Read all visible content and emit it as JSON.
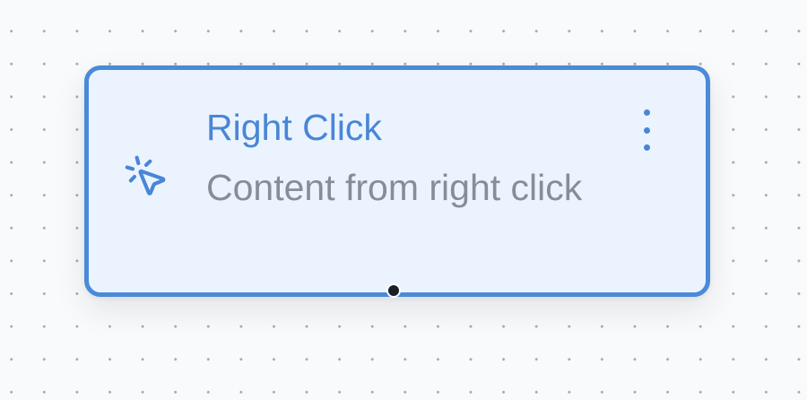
{
  "canvas": {
    "background": "#f9fafb",
    "grid_dot_color": "#a5a9b0"
  },
  "node": {
    "icon": "click-cursor-icon",
    "title": "Right Click",
    "subtitle": "Content from right click",
    "menu_icon": "vertical-dots-icon",
    "accent_color": "#4a8ad8",
    "background_color": "#ebf4fe",
    "handle_color": "#1b1e26",
    "selected": true
  }
}
